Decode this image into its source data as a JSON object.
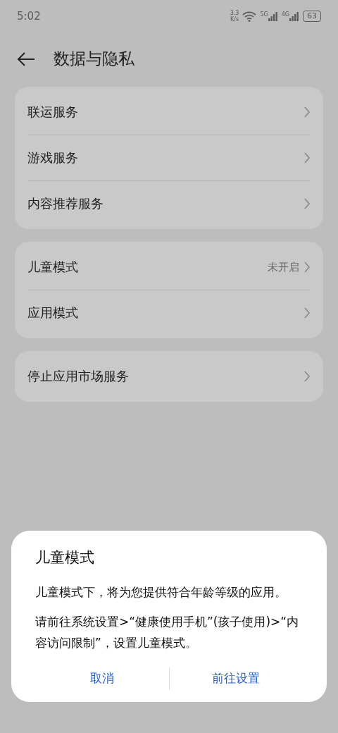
{
  "status_bar": {
    "time": "5:02",
    "speed_value": "3.3",
    "speed_unit": "K/s",
    "network_1": "5G",
    "network_2": "4G",
    "battery": "63"
  },
  "header": {
    "title": "数据与隐私"
  },
  "groups": [
    {
      "items": [
        {
          "label": "联运服务"
        },
        {
          "label": "游戏服务"
        },
        {
          "label": "内容推荐服务"
        }
      ]
    },
    {
      "items": [
        {
          "label": "儿童模式",
          "value": "未开启"
        },
        {
          "label": "应用模式"
        }
      ]
    },
    {
      "items": [
        {
          "label": "停止应用市场服务"
        }
      ]
    }
  ],
  "dialog": {
    "title": "儿童模式",
    "paragraphs": [
      "儿童模式下，将为您提供符合年龄等级的应用。",
      "请前往系统设置>“健康使用手机”(孩子使用)>“内容访问限制”，设置儿童模式。"
    ],
    "buttons": [
      "取消",
      "前往设置"
    ]
  }
}
